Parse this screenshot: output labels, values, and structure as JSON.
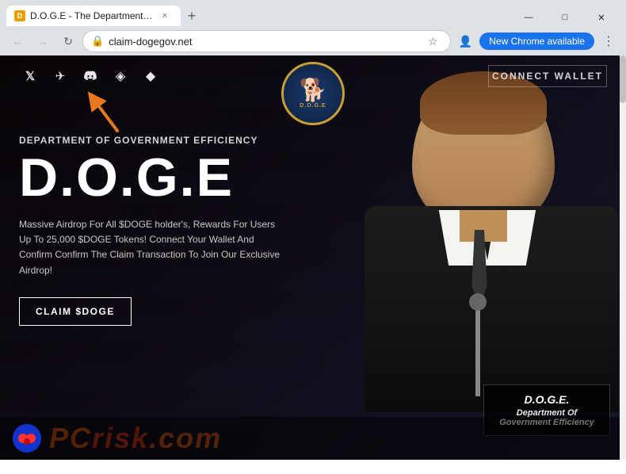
{
  "browser": {
    "tab": {
      "favicon_label": "D",
      "title": "D.O.G.E - The Department of G...",
      "close_label": "×"
    },
    "new_tab_label": "+",
    "window_controls": {
      "minimize": "—",
      "maximize": "□",
      "close": "✕"
    },
    "address_bar": {
      "url": "claim-dogegov.net",
      "star_icon": "☆",
      "profile_icon": "👤"
    },
    "update_btn_label": "New Chrome available",
    "menu_icon": "⋮"
  },
  "website": {
    "nav": {
      "connect_wallet": "CONNECT WALLET",
      "social_icons": [
        {
          "name": "x-twitter",
          "symbol": "𝕏"
        },
        {
          "name": "telegram",
          "symbol": "✈"
        },
        {
          "name": "discord",
          "symbol": "⬡"
        },
        {
          "name": "opensea",
          "symbol": "◈"
        },
        {
          "name": "ethereum",
          "symbol": "◆"
        }
      ]
    },
    "logo": {
      "emoji": "🐕",
      "text": "D.O.G.E"
    },
    "arrow_indicator": "▲",
    "hero": {
      "subtitle": "DEPARTMENT OF GOVERNMENT EFFICIENCY",
      "title": "D.O.G.E",
      "description": "Massive Airdrop For All $DOGE holder's, Rewards For Users Up To 25,000 $DOGE Tokens! Connect Your Wallet And Confirm Confirm The Claim Transaction To Join Our Exclusive Airdrop!",
      "cta_button": "CLAIM $DOGE"
    },
    "podium": {
      "line1": "D.O.G.E.",
      "line2": "Department Of",
      "line3": "Government Efficiency"
    },
    "watermark": {
      "logo_emoji": "🔵",
      "text_main": "PC",
      "text_accent": "risk",
      "text_suffix": ".com"
    }
  },
  "colors": {
    "bg_dark": "#1a1a2e",
    "accent_gold": "#c8a034",
    "text_white": "#ffffff",
    "text_gray": "#c8c8c8",
    "nav_text": "#d4d4d4",
    "btn_border": "rgba(255,255,255,0.5)"
  }
}
